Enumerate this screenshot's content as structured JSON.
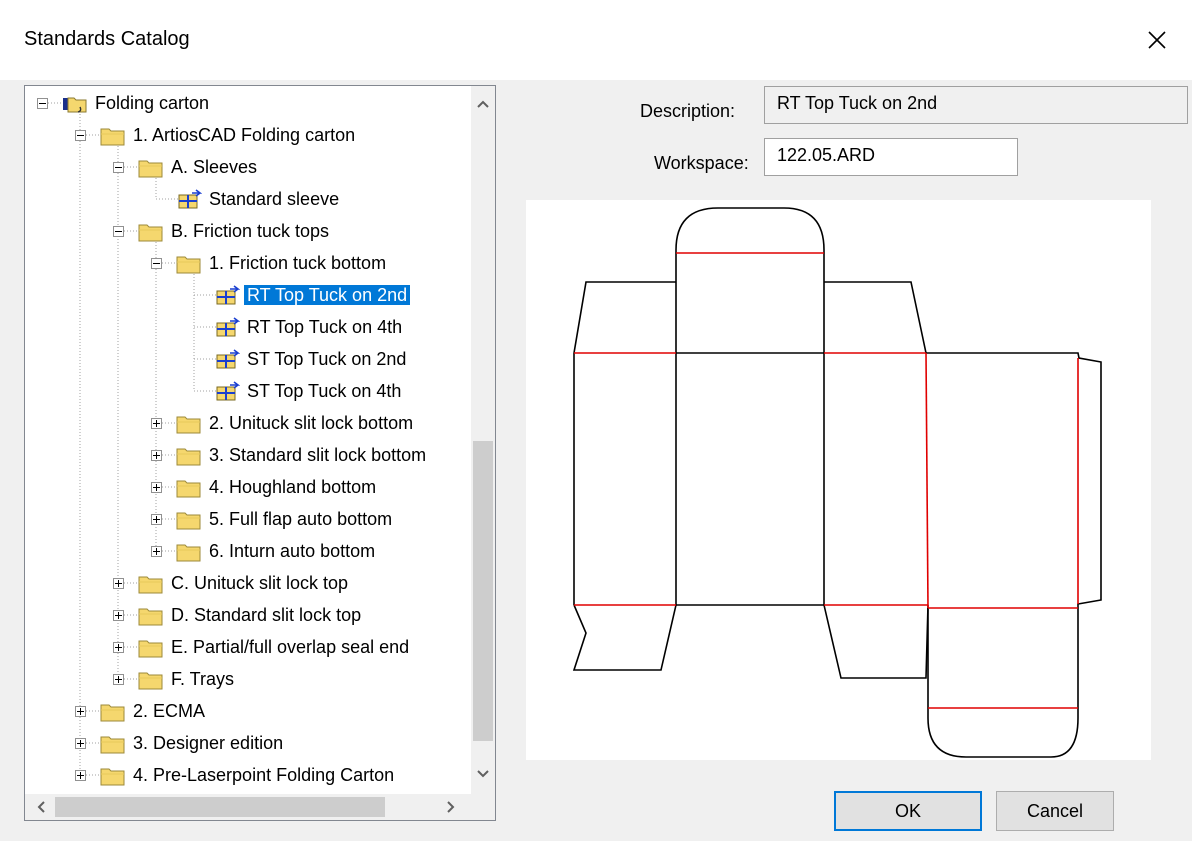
{
  "window": {
    "title": "Standards Catalog"
  },
  "tree": {
    "items": [
      {
        "label": "Folding carton",
        "level": 0,
        "toggle": "minus",
        "icon": "folder-open-icon"
      },
      {
        "label": "1. ArtiosCAD Folding carton",
        "level": 1,
        "toggle": "minus",
        "icon": "folder-icon"
      },
      {
        "label": "A. Sleeves",
        "level": 2,
        "toggle": "minus",
        "icon": "folder-icon"
      },
      {
        "label": "Standard sleeve",
        "level": 3,
        "toggle": "none",
        "icon": "design-icon"
      },
      {
        "label": "B. Friction tuck tops",
        "level": 2,
        "toggle": "minus",
        "icon": "folder-icon"
      },
      {
        "label": "1. Friction tuck bottom",
        "level": 3,
        "toggle": "minus",
        "icon": "folder-icon"
      },
      {
        "label": "RT Top Tuck on 2nd",
        "level": 4,
        "toggle": "none",
        "icon": "design-icon",
        "selected": true
      },
      {
        "label": "RT Top Tuck on 4th",
        "level": 4,
        "toggle": "none",
        "icon": "design-icon"
      },
      {
        "label": "ST Top Tuck on 2nd",
        "level": 4,
        "toggle": "none",
        "icon": "design-icon"
      },
      {
        "label": "ST Top Tuck on 4th",
        "level": 4,
        "toggle": "none",
        "icon": "design-icon"
      },
      {
        "label": "2. Unituck slit lock bottom",
        "level": 3,
        "toggle": "plus",
        "icon": "folder-icon"
      },
      {
        "label": "3. Standard slit lock bottom",
        "level": 3,
        "toggle": "plus",
        "icon": "folder-icon"
      },
      {
        "label": "4. Houghland bottom",
        "level": 3,
        "toggle": "plus",
        "icon": "folder-icon"
      },
      {
        "label": "5. Full flap auto bottom",
        "level": 3,
        "toggle": "plus",
        "icon": "folder-icon"
      },
      {
        "label": "6. Inturn auto bottom",
        "level": 3,
        "toggle": "plus",
        "icon": "folder-icon"
      },
      {
        "label": "C. Unituck slit lock top",
        "level": 2,
        "toggle": "plus",
        "icon": "folder-icon"
      },
      {
        "label": "D. Standard slit lock top",
        "level": 2,
        "toggle": "plus",
        "icon": "folder-icon"
      },
      {
        "label": "E. Partial/full overlap seal end",
        "level": 2,
        "toggle": "plus",
        "icon": "folder-icon"
      },
      {
        "label": "F. Trays",
        "level": 2,
        "toggle": "plus",
        "icon": "folder-icon"
      },
      {
        "label": "2. ECMA",
        "level": 1,
        "toggle": "plus",
        "icon": "folder-icon"
      },
      {
        "label": "3. Designer edition",
        "level": 1,
        "toggle": "plus",
        "icon": "folder-icon"
      },
      {
        "label": "4. Pre-Laserpoint Folding Carton",
        "level": 1,
        "toggle": "plus",
        "icon": "folder-icon"
      }
    ]
  },
  "description": {
    "label": "Description:",
    "value": "RT Top Tuck on 2nd"
  },
  "workspace": {
    "label": "Workspace:",
    "value": "122.05.ARD"
  },
  "buttons": {
    "ok": "OK",
    "cancel": "Cancel"
  },
  "colors": {
    "selection": "#0078d7",
    "cut_line": "#000000",
    "crease_line": "#e00000",
    "folder": "#f5d76e"
  }
}
